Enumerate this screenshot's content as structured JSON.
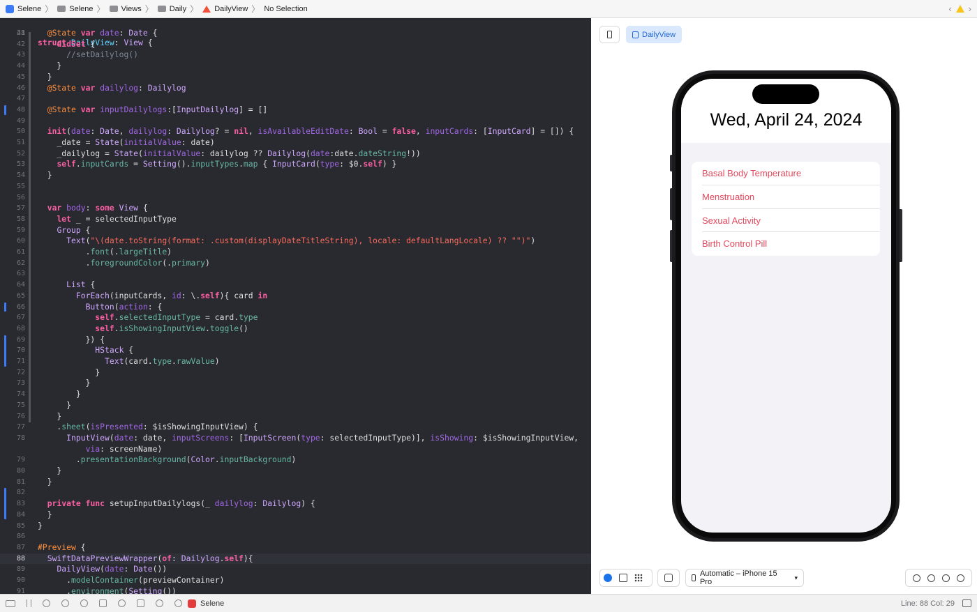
{
  "breadcrumb": [
    {
      "label": "Selene",
      "icon": "app-icon"
    },
    {
      "label": "Selene",
      "icon": "folder-icon"
    },
    {
      "label": "Views",
      "icon": "folder-icon"
    },
    {
      "label": "Daily",
      "icon": "folder-icon"
    },
    {
      "label": "DailyView",
      "icon": "swift-file-icon"
    },
    {
      "label": "No Selection",
      "icon": ""
    }
  ],
  "editor": {
    "sticky_line": {
      "num": "28",
      "code": "struct DailyView: View {"
    },
    "current_line": "88",
    "lines": [
      {
        "num": "41",
        "code": "  @State var date: Date {"
      },
      {
        "num": "42",
        "code": "    didSet {"
      },
      {
        "num": "43",
        "code": "      //setDailylog()"
      },
      {
        "num": "44",
        "code": "    }"
      },
      {
        "num": "45",
        "code": "  }"
      },
      {
        "num": "46",
        "code": "  @State var dailylog: Dailylog"
      },
      {
        "num": "47",
        "code": ""
      },
      {
        "num": "48",
        "code": "  @State var inputDailylogs:[InputDailylog] = []"
      },
      {
        "num": "49",
        "code": ""
      },
      {
        "num": "50",
        "code": "  init(date: Date, dailylog: Dailylog? = nil, isAvailableEditDate: Bool = false, inputCards: [InputCard] = []) {"
      },
      {
        "num": "51",
        "code": "    _date = State(initialValue: date)"
      },
      {
        "num": "52",
        "code": "    _dailylog = State(initialValue: dailylog ?? Dailylog(date:date.dateString!))"
      },
      {
        "num": "53",
        "code": "    self.inputCards = Setting().inputTypes.map { InputCard(type: $0.self) }"
      },
      {
        "num": "54",
        "code": "  }"
      },
      {
        "num": "55",
        "code": ""
      },
      {
        "num": "56",
        "code": ""
      },
      {
        "num": "57",
        "code": "  var body: some View {"
      },
      {
        "num": "58",
        "code": "    let _ = selectedInputType"
      },
      {
        "num": "59",
        "code": "    Group {"
      },
      {
        "num": "60",
        "code": "      Text(\"\\(date.toString(format: .custom(displayDateTitleString), locale: defaultLangLocale) ?? \"\")\")"
      },
      {
        "num": "61",
        "code": "          .font(.largeTitle)"
      },
      {
        "num": "62",
        "code": "          .foregroundColor(.primary)"
      },
      {
        "num": "63",
        "code": ""
      },
      {
        "num": "64",
        "code": "      List {"
      },
      {
        "num": "65",
        "code": "        ForEach(inputCards, id: \\.self){ card in"
      },
      {
        "num": "66",
        "code": "          Button(action: {"
      },
      {
        "num": "67",
        "code": "            self.selectedInputType = card.type"
      },
      {
        "num": "68",
        "code": "            self.isShowingInputView.toggle()"
      },
      {
        "num": "69",
        "code": "          }) {"
      },
      {
        "num": "70",
        "code": "            HStack {"
      },
      {
        "num": "71",
        "code": "              Text(card.type.rawValue)"
      },
      {
        "num": "72",
        "code": "            }"
      },
      {
        "num": "73",
        "code": "          }"
      },
      {
        "num": "74",
        "code": "        }"
      },
      {
        "num": "75",
        "code": "      }"
      },
      {
        "num": "76",
        "code": "    }"
      },
      {
        "num": "77",
        "code": "    .sheet(isPresented: $isShowingInputView) {"
      },
      {
        "num": "78",
        "code": "      InputView(date: date, inputScreens: [InputScreen(type: selectedInputType)], isShowing: $isShowingInputView,"
      },
      {
        "num": "",
        "code": "          via: screenName)"
      },
      {
        "num": "79",
        "code": "        .presentationBackground(Color.inputBackground)"
      },
      {
        "num": "80",
        "code": "    }"
      },
      {
        "num": "81",
        "code": "  }"
      },
      {
        "num": "82",
        "code": ""
      },
      {
        "num": "83",
        "code": "  private func setupInputDailylogs(_ dailylog: Dailylog) {"
      },
      {
        "num": "84",
        "code": "  }"
      },
      {
        "num": "85",
        "code": "}"
      },
      {
        "num": "86",
        "code": ""
      },
      {
        "num": "87",
        "code": "#Preview {"
      },
      {
        "num": "88",
        "code": "  SwiftDataPreviewWrapper(of: Dailylog.self){"
      },
      {
        "num": "89",
        "code": "    DailyView(date: Date())"
      },
      {
        "num": "90",
        "code": "      .modelContainer(previewContainer)"
      },
      {
        "num": "91",
        "code": "      .environment(Setting())"
      }
    ]
  },
  "canvas": {
    "preview_tab": "DailyView",
    "date_title": "Wed, April 24, 2024",
    "list_items": [
      "Basal Body Temperature",
      "Menstruation",
      "Sexual Activity",
      "Birth Control Pill"
    ],
    "device_selector": "Automatic – iPhone 15 Pro",
    "accent_color": "#e2485d"
  },
  "statusbar": {
    "scheme": "Selene",
    "line_col": "Line: 88  Col: 29"
  }
}
